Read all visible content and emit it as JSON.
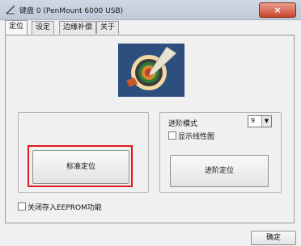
{
  "window": {
    "title": "键盘 0 (PenMount 6000 USB)",
    "close_label": "×"
  },
  "tabs": [
    {
      "label": "定位",
      "active": true
    },
    {
      "label": "设定",
      "active": false
    },
    {
      "label": "边缘补偿",
      "active": false
    },
    {
      "label": "关于",
      "active": false
    }
  ],
  "calibration": {
    "standard_button": "标准定位",
    "advanced_mode_label": "进阶模式",
    "advanced_mode_value": "9",
    "show_line_chart_label": "显示线性图",
    "show_line_chart_checked": false,
    "advanced_button": "进阶定位",
    "eeprom_label": "关闭存入EEPROM功能",
    "eeprom_checked": false
  },
  "footer": {
    "ok_label": "确定"
  },
  "colors": {
    "highlight": "#e0191e",
    "logo_bg": "#2c4f7e"
  }
}
